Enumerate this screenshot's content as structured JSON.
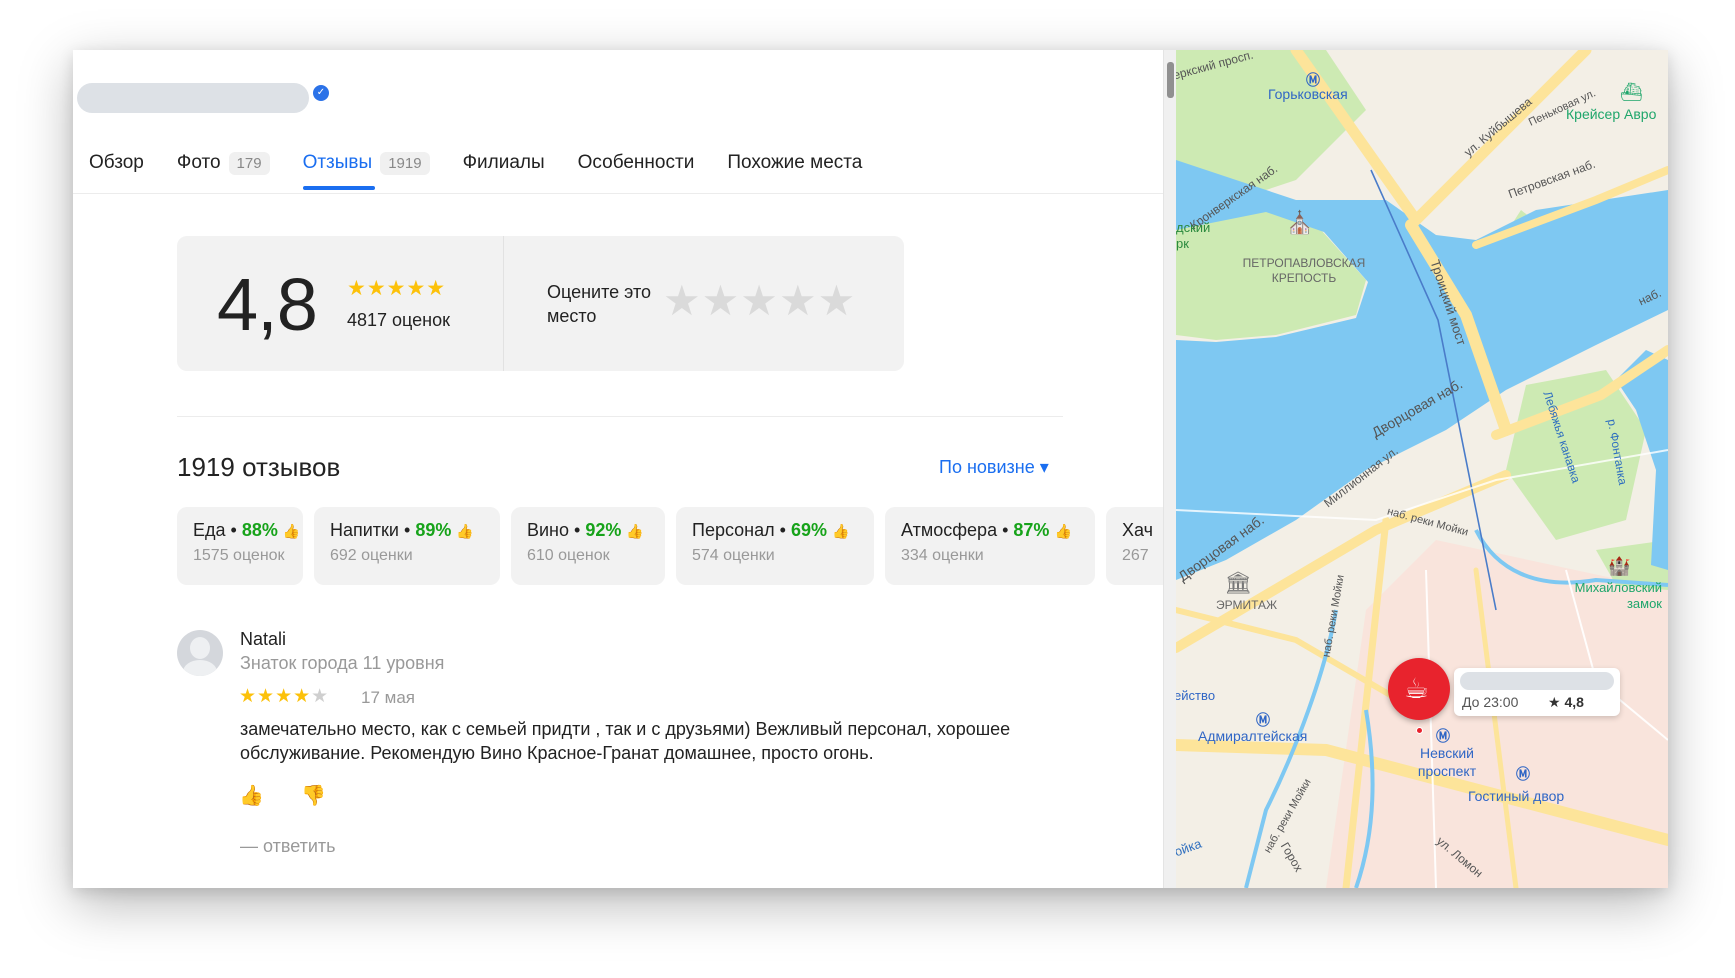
{
  "header": {
    "verified_icon": "check-badge-icon"
  },
  "tabs": [
    {
      "label": "Обзор",
      "count": ""
    },
    {
      "label": "Фото",
      "count": "179"
    },
    {
      "label": "Отзывы",
      "count": "1919"
    },
    {
      "label": "Филиалы",
      "count": ""
    },
    {
      "label": "Особенности",
      "count": ""
    },
    {
      "label": "Похожие места",
      "count": ""
    }
  ],
  "active_tab": "Отзывы",
  "rating": {
    "value": "4,8",
    "stars": 5,
    "count_text": "4817 оценок",
    "rate_prompt": "Оцените это место",
    "rate_stars": "★★★★★"
  },
  "reviews": {
    "title": "1919 отзывов",
    "sort_label": "По новизне ▾"
  },
  "aspects": [
    {
      "name": "Еда",
      "pct": "88%",
      "count": "1575 оценок"
    },
    {
      "name": "Напитки",
      "pct": "89%",
      "count": "692 оценки"
    },
    {
      "name": "Вино",
      "pct": "92%",
      "count": "610 оценок"
    },
    {
      "name": "Персонал",
      "pct": "69%",
      "count": "574 оценки"
    },
    {
      "name": "Атмосфера",
      "pct": "87%",
      "count": "334 оценки"
    },
    {
      "name": "Хач",
      "pct": "",
      "count": "267"
    }
  ],
  "review": {
    "author": "Natali",
    "level": "Знаток города 11 уровня",
    "stars": 4,
    "stars_on": "★★★★",
    "stars_off": "★",
    "date": "17 мая",
    "text": "замечательно место, как с семьей придти , так и с друзьями) Вежливый персонал, хорошее обслуживание. Рекомендую Вино Красное-Гранат домашнее, просто огонь.",
    "reply": "— ответить",
    "like_icon": "👍",
    "dislike_icon": "👎"
  },
  "map": {
    "labels": {
      "gorkovskaya": "Горьковская",
      "kreiser": "Крейсер Авро",
      "kuibysheva": "ул. Куйбышева",
      "pentkovaya": "Пеньковая ул.",
      "petrovskaya": "Петровская наб.",
      "kronverksky_pr": "еркский просп.",
      "kronverkskaya": "Кронверкская наб.",
      "dsky_park": "дский рк",
      "petropavlovskaya": "ПЕТРОПАВЛОВСКАЯ КРЕПОСТЬ",
      "troitsky": "Троицкий мост",
      "nab": "наб.",
      "dvortsovaya1": "Дворцовая наб.",
      "lebyazhya": "Лебяжья канавка",
      "fontanka": "р. Фонтанка",
      "millionnaya": "Миллионная ул.",
      "moika": "наб. реки Мойки",
      "dvortsovaya2": "Дворцовая наб.",
      "hermitage": "ЭРМИТАЖ",
      "mikhailovsky": "Михайловский замок",
      "moika_vert": "наб. реки Мойки",
      "deistvo": "ействo",
      "admiralteyskaya": "Адмиралтейская",
      "nevsky": "Невский проспект",
      "gostiny": "Гостиный двор",
      "moika2": "наб. реки Мойки",
      "oika": "ойка",
      "gorokh": "Горох",
      "lomon": "ул. Ломон"
    },
    "place": {
      "hours": "До 23:00",
      "rating": "★ 4,8",
      "icon": "coffee-cup-icon"
    },
    "colors": {
      "water": "#7ec8f2",
      "park": "#cdeab3",
      "road": "#fde49a",
      "land": "#f3efe6",
      "center": "#f9e4dc",
      "pin": "#e8232d"
    }
  }
}
